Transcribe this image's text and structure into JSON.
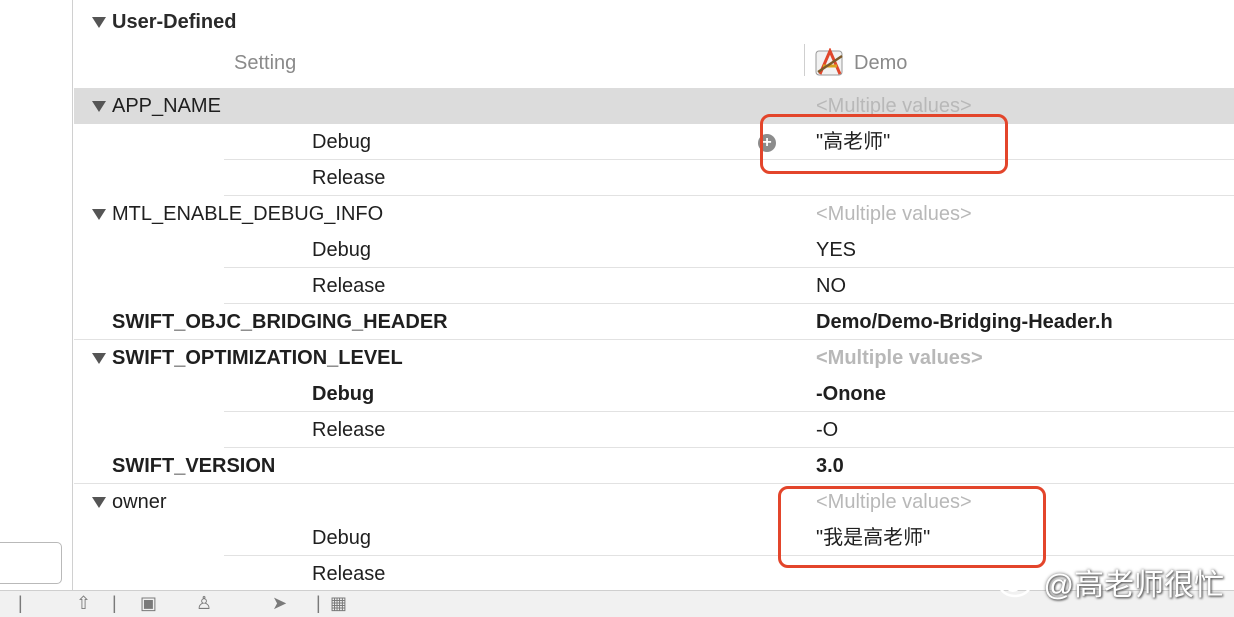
{
  "section": {
    "title": "User-Defined"
  },
  "columns": {
    "setting": "Setting",
    "target": "Demo"
  },
  "rows": [
    {
      "name": "APP_NAME",
      "value": "<Multiple values>"
    },
    {
      "sub": "Debug",
      "value": "\"高老师\""
    },
    {
      "sub": "Release",
      "value": ""
    },
    {
      "name": "MTL_ENABLE_DEBUG_INFO",
      "value": "<Multiple values>"
    },
    {
      "sub": "Debug",
      "value": "YES"
    },
    {
      "sub": "Release",
      "value": "NO"
    },
    {
      "name": "SWIFT_OBJC_BRIDGING_HEADER",
      "value": "Demo/Demo-Bridging-Header.h"
    },
    {
      "name": "SWIFT_OPTIMIZATION_LEVEL",
      "value": "<Multiple values>"
    },
    {
      "sub": "Debug",
      "value": "-Onone"
    },
    {
      "sub": "Release",
      "value": "-O"
    },
    {
      "name": "SWIFT_VERSION",
      "value": "3.0"
    },
    {
      "name": "owner",
      "value": "<Multiple values>"
    },
    {
      "sub": "Debug",
      "value": "\"我是高老师\""
    },
    {
      "sub": "Release",
      "value": ""
    }
  ],
  "watermark": {
    "text": "@高老师很忙"
  },
  "colors": {
    "callout": "#e3452b",
    "selected_row": "#dcdcdc",
    "multiple_values": "#b8b8b8"
  },
  "icons": {
    "target": "app-target-icon",
    "add": "plus-circle-icon",
    "weibo": "weibo-logo-icon"
  }
}
